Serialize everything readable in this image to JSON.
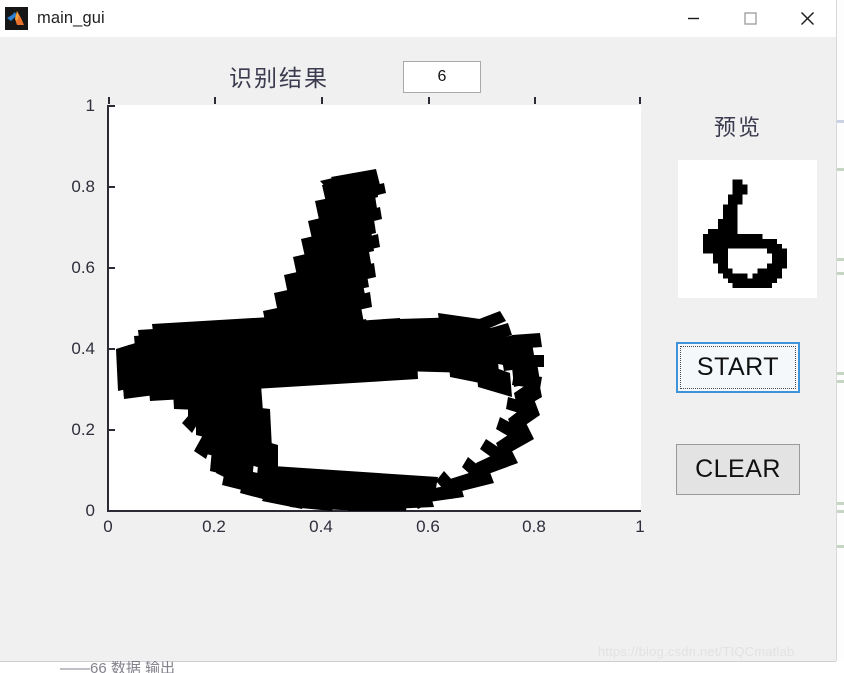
{
  "window": {
    "title": "main_gui",
    "icon": "matlab-membrane-icon",
    "controls": {
      "minimize": "minimize-icon",
      "maximize": "maximize-icon",
      "close": "close-icon"
    }
  },
  "header": {
    "result_label": "识别结果",
    "result_value": "6"
  },
  "plot": {
    "y_ticks": [
      "1",
      "0.8",
      "0.6",
      "0.4",
      "0.2",
      "0"
    ],
    "y_tick_values": [
      1,
      0.8,
      0.6,
      0.4,
      0.2,
      0
    ],
    "x_ticks": [
      "0",
      "0.2",
      "0.4",
      "0.6",
      "0.8",
      "1"
    ],
    "x_tick_values": [
      0,
      0.2,
      0.4,
      0.6,
      0.8,
      1
    ],
    "xlim": [
      0,
      1
    ],
    "ylim": [
      0,
      1
    ],
    "drawn_digit": "6",
    "stroke_color": "#000000",
    "background": "#ffffff"
  },
  "side_panel": {
    "preview_label": "预览",
    "preview_digit": "6",
    "start_label": "START",
    "clear_label": "CLEAR",
    "start_focus_color": "#3f93d8",
    "clear_face_color": "#e3e3e3"
  },
  "watermark": {
    "text": "https://blog.csdn.net/TIQCmatlab"
  },
  "below_window": {
    "partial_text": "——66 数据 输出"
  }
}
